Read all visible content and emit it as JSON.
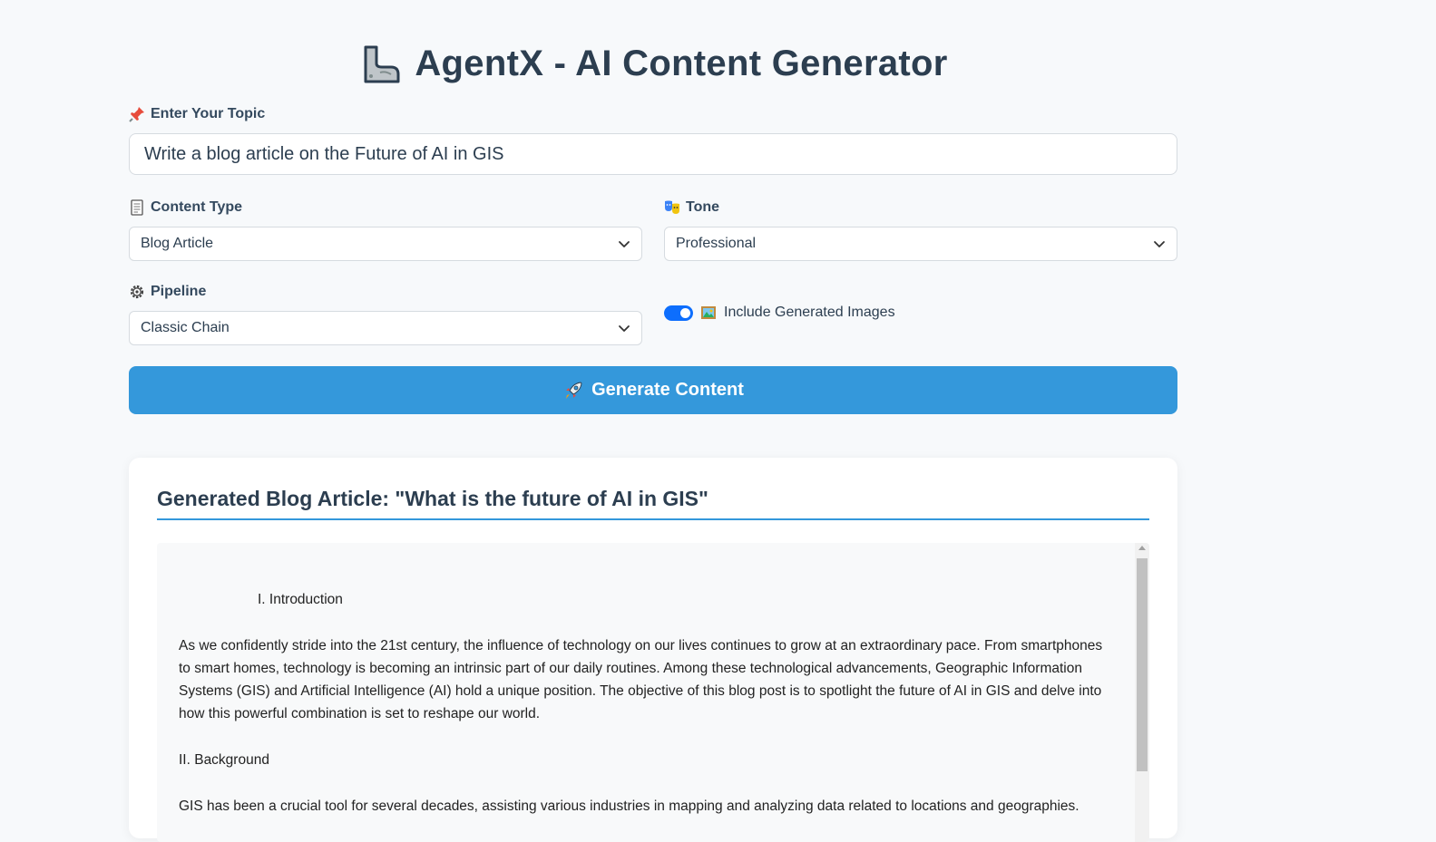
{
  "app": {
    "title": "AgentX - AI Content Generator",
    "icon": "flexed-biceps-icon"
  },
  "topic": {
    "label": "Enter Your Topic",
    "icon": "pushpin-icon",
    "value": "Write a blog article on the Future of AI in GIS"
  },
  "content_type": {
    "label": "Content Type",
    "icon": "page-icon",
    "selected": "Blog Article"
  },
  "tone": {
    "label": "Tone",
    "icon": "theater-masks-icon",
    "selected": "Professional"
  },
  "pipeline": {
    "label": "Pipeline",
    "icon": "gear-icon",
    "selected": "Classic Chain"
  },
  "images_toggle": {
    "label": "Include Generated Images",
    "icon": "framed-picture-icon",
    "checked": true
  },
  "generate": {
    "label": "Generate Content",
    "icon": "rocket-icon"
  },
  "result": {
    "title": "Generated Blog Article: \"What is the future of AI in GIS\"",
    "paragraphs": [
      "I. Introduction",
      "As we confidently stride into the 21st century, the influence of technology on our lives continues to grow at an extraordinary pace. From smartphones to smart homes, technology is becoming an intrinsic part of our daily routines. Among these technological advancements, Geographic Information Systems (GIS) and Artificial Intelligence (AI) hold a unique position. The objective of this blog post is to spotlight the future of AI in GIS and delve into how this powerful combination is set to reshape our world.",
      "II. Background",
      "GIS has been a crucial tool for several decades, assisting various industries in mapping and analyzing data related to locations and geographies."
    ]
  },
  "colors": {
    "accent": "#3498db",
    "toggle": "#0d6efd",
    "heading": "#2c3e50",
    "background": "#f7f9fb"
  }
}
